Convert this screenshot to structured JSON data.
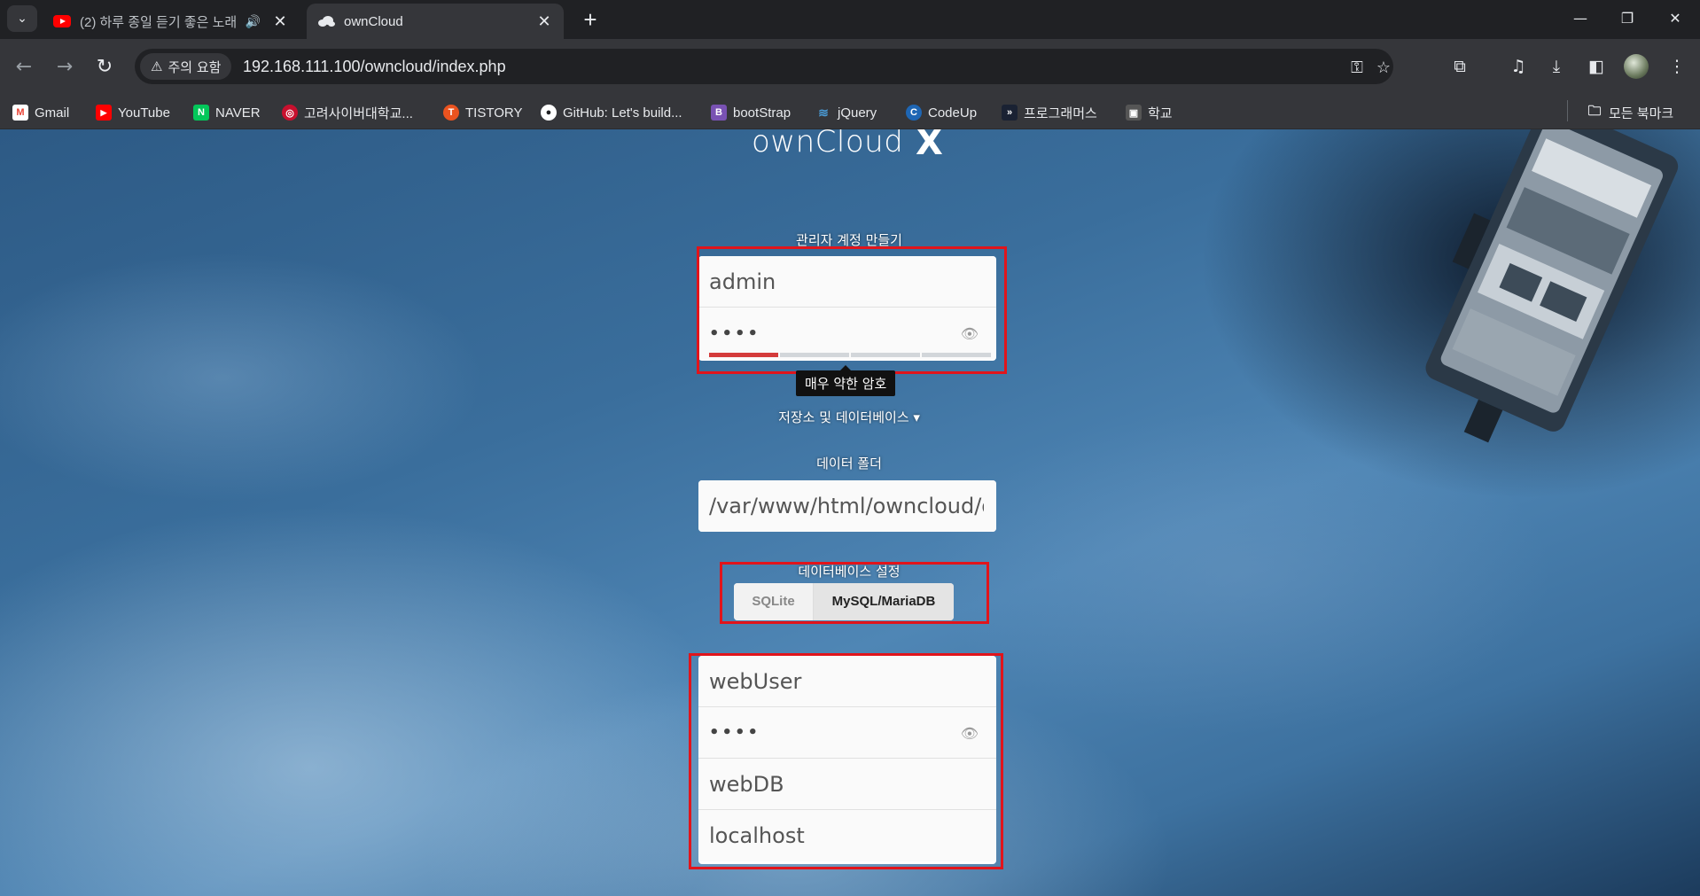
{
  "browser": {
    "tabs": [
      {
        "title": "(2) 하루 종일 듣기 좋은 노래",
        "active": false,
        "icon": "youtube-icon",
        "audio": true
      },
      {
        "title": "ownCloud",
        "active": true,
        "icon": "owncloud-icon"
      }
    ],
    "security_chip": "주의 요함",
    "url": "192.168.111.100/owncloud/index.php",
    "bookmarks": [
      {
        "label": "Gmail",
        "icon": "gmail-icon",
        "color": "#ea4335",
        "glyph": "M"
      },
      {
        "label": "YouTube",
        "icon": "youtube-icon",
        "color": "#ff0000",
        "glyph": "▶"
      },
      {
        "label": "NAVER",
        "icon": "naver-icon",
        "color": "#03c75a",
        "glyph": "N"
      },
      {
        "label": "고려사이버대학교...",
        "icon": "university-icon",
        "color": "#c8102e",
        "glyph": "◎"
      },
      {
        "label": "TISTORY",
        "icon": "tistory-icon",
        "color": "#eb531f",
        "glyph": "T"
      },
      {
        "label": "GitHub: Let's build...",
        "icon": "github-icon",
        "color": "#202124",
        "glyph": "●"
      },
      {
        "label": "bootStrap",
        "icon": "bootstrap-icon",
        "color": "#7952b3",
        "glyph": "B"
      },
      {
        "label": "jQuery",
        "icon": "jquery-icon",
        "color": "#0769ad",
        "glyph": "≋"
      },
      {
        "label": "CodeUp",
        "icon": "codeup-icon",
        "color": "#1e66b4",
        "glyph": "C"
      },
      {
        "label": "프로그래머스",
        "icon": "programmers-icon",
        "color": "#1a2233",
        "glyph": "»"
      },
      {
        "label": "학교",
        "icon": "school-icon",
        "color": "#555555",
        "glyph": "▣"
      }
    ],
    "all_bookmarks": "모든 북마크"
  },
  "page": {
    "logo_text": "ownCloud",
    "logo_x": "X",
    "admin_section_label": "관리자 계정 만들기",
    "admin_username": "admin",
    "admin_password_mask": "••••",
    "password_strength": {
      "filled_segments": 1,
      "total_segments": 4,
      "label": "매우 약한 암호"
    },
    "storage_toggle": "저장소 및 데이터베이스 ▾",
    "data_folder_label": "데이터 폴더",
    "data_folder_value": "/var/www/html/owncloud/data",
    "db_section_label": "데이터베이스 설정",
    "db_options": [
      "SQLite",
      "MySQL/MariaDB"
    ],
    "db_selected": "MySQL/MariaDB",
    "db_user": "webUser",
    "db_password_mask": "••••",
    "db_name": "webDB",
    "db_host": "localhost"
  },
  "colors": {
    "highlight_box": "#e1141b",
    "strength_weak": "#d43b3b"
  }
}
